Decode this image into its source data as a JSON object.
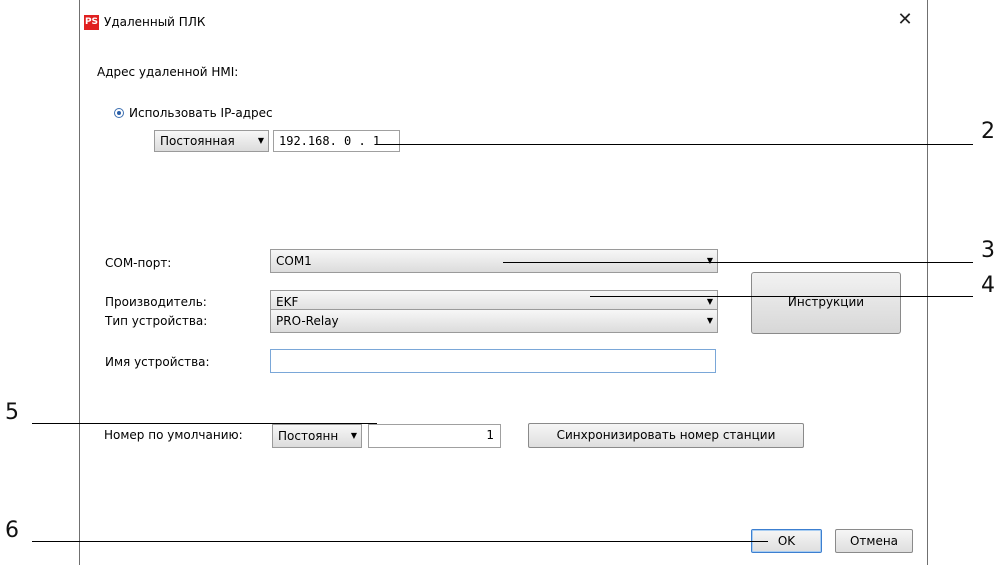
{
  "window": {
    "title": "Удаленный ПЛК",
    "icon_text": "PS",
    "close_symbol": "✕"
  },
  "labels": {
    "remote_address": "Адрес удаленной HMI:",
    "use_ip": "Использовать IP-адрес",
    "com_port": "COM-порт:",
    "manufacturer": "Производитель:",
    "device_type": "Тип устройства:",
    "device_name": "Имя устройства:",
    "default_number": "Номер по умолчанию:"
  },
  "controls": {
    "ip_mode": "Постоянная",
    "ip_address": "192.168. 0 . 1",
    "com_port": "COM1",
    "manufacturer": "EKF",
    "device_type": "PRO-Relay",
    "device_name": "",
    "number_mode": "Постоянн",
    "station_number": "1",
    "dropdown_arrow": "▼"
  },
  "buttons": {
    "instructions": "Инструкции",
    "sync_station": "Синхронизировать номер станции",
    "ok": "OK",
    "cancel": "Отмена"
  },
  "callouts": [
    "2",
    "3",
    "4",
    "5",
    "6"
  ]
}
